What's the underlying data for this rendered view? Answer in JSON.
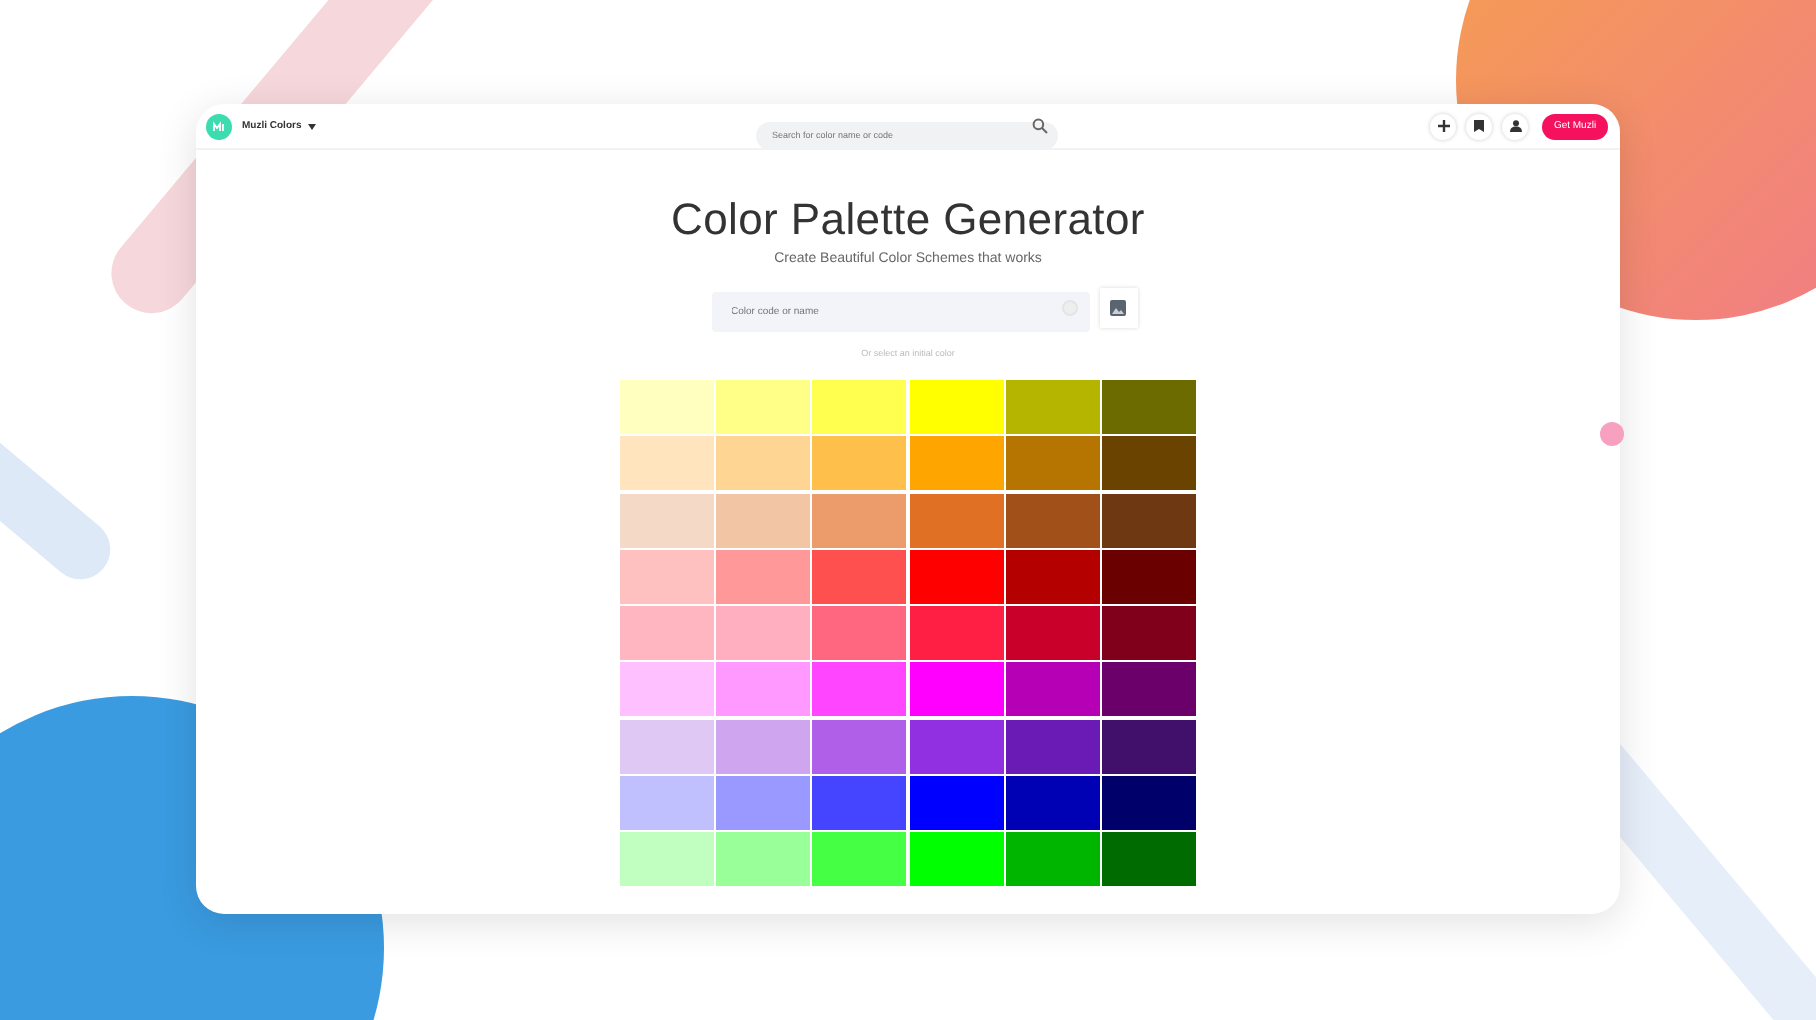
{
  "header": {
    "brand": "Muzli Colors",
    "search_placeholder": "Search for color name or code",
    "cta": "Get Muzli"
  },
  "hero": {
    "title": "Color Palette Generator",
    "subtitle": "Create Beautiful Color Schemes that works",
    "input_placeholder": "Color code or name",
    "hint": "Or select an initial color"
  },
  "swatch_rows": [
    [
      {
        "color": "#ffffc0"
      },
      {
        "color": "#ffff88"
      },
      {
        "color": "#ffff50"
      },
      {
        "color": "#ffff00"
      },
      {
        "color": "#b5b500"
      },
      {
        "color": "#6b6b00"
      }
    ],
    [
      {
        "color": "#ffe4bd"
      },
      {
        "color": "#ffd594"
      },
      {
        "color": "#ffbf4b"
      },
      {
        "color": "#ffa500"
      },
      {
        "color": "#b57500"
      },
      {
        "color": "#6b4300"
      }
    ],
    [
      {
        "color": "#f4dac6"
      },
      {
        "color": "#f2c6a4"
      },
      {
        "color": "#eb9c6a"
      },
      {
        "color": "#e07024"
      },
      {
        "color": "#a05018"
      },
      {
        "color": "#6e3812"
      }
    ],
    [
      {
        "color": "#ffc0c0"
      },
      {
        "color": "#ff9999"
      },
      {
        "color": "#ff5050"
      },
      {
        "color": "#ff0000"
      },
      {
        "color": "#b50000"
      },
      {
        "color": "#6b0000"
      }
    ],
    [
      {
        "color": "#ffb6c1"
      },
      {
        "color": "#ffafc0"
      },
      {
        "color": "#ff6680"
      },
      {
        "color": "#ff1f44"
      },
      {
        "color": "#c8002a"
      },
      {
        "color": "#80001b"
      }
    ],
    [
      {
        "color": "#ffc0ff"
      },
      {
        "color": "#ff99ff"
      },
      {
        "color": "#ff45ff"
      },
      {
        "color": "#ff00ff"
      },
      {
        "color": "#b500b5"
      },
      {
        "color": "#6b006b"
      }
    ],
    [
      {
        "color": "#e0c8f5"
      },
      {
        "color": "#d0a5f0"
      },
      {
        "color": "#b060e8"
      },
      {
        "color": "#9030e0"
      },
      {
        "color": "#6b1bb5"
      },
      {
        "color": "#40106b"
      }
    ],
    [
      {
        "color": "#c0c0ff"
      },
      {
        "color": "#9999ff"
      },
      {
        "color": "#4545ff"
      },
      {
        "color": "#0000ff"
      },
      {
        "color": "#0000b5"
      },
      {
        "color": "#00006b"
      }
    ],
    [
      {
        "color": "#c0ffc0"
      },
      {
        "color": "#99ff99"
      },
      {
        "color": "#45ff45"
      },
      {
        "color": "#00ff00"
      },
      {
        "color": "#00b500"
      },
      {
        "color": "#006b00"
      }
    ]
  ]
}
